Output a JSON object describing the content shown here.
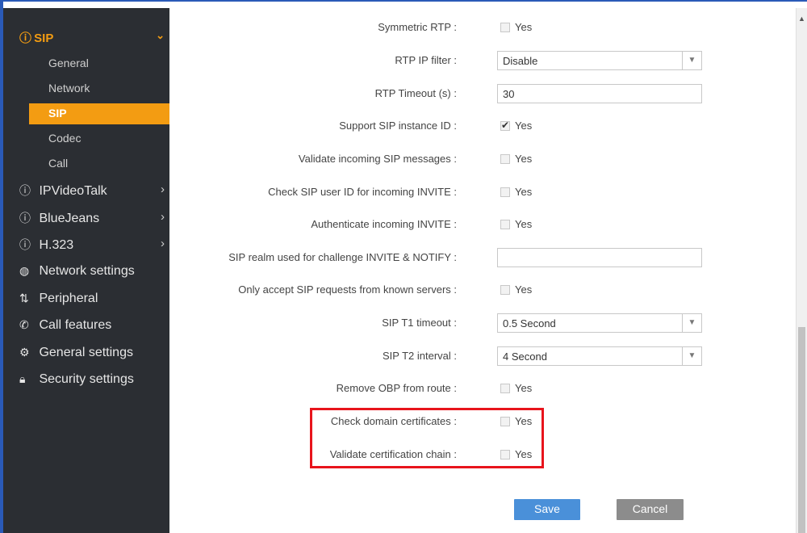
{
  "sidebar": {
    "sip_header": "SIP",
    "sub_items": [
      "General",
      "Network",
      "SIP",
      "Codec",
      "Call"
    ],
    "nav_items": [
      {
        "label": "IPVideoTalk",
        "icon": "info-circle-icon"
      },
      {
        "label": "BlueJeans",
        "icon": "info-circle-icon"
      },
      {
        "label": "H.323",
        "icon": "info-circle-icon"
      },
      {
        "label": "Network settings",
        "icon": "globe-icon"
      },
      {
        "label": "Peripheral",
        "icon": "plug-icon"
      },
      {
        "label": "Call features",
        "icon": "phone-icon"
      },
      {
        "label": "General settings",
        "icon": "gear-icon"
      },
      {
        "label": "Security settings",
        "icon": "lock-icon"
      }
    ]
  },
  "form": {
    "symmetric_rtp": {
      "label": "Symmetric RTP :",
      "checked": false,
      "yes": "Yes"
    },
    "rtp_ip_filter": {
      "label": "RTP IP filter :",
      "value": "Disable"
    },
    "rtp_timeout": {
      "label": "RTP Timeout (s) :",
      "value": "30"
    },
    "support_sip_instance_id": {
      "label": "Support SIP instance ID :",
      "checked": true,
      "yes": "Yes"
    },
    "validate_incoming": {
      "label": "Validate incoming SIP messages :",
      "checked": false,
      "yes": "Yes"
    },
    "check_sip_user_id": {
      "label": "Check SIP user ID for incoming INVITE :",
      "checked": false,
      "yes": "Yes"
    },
    "authenticate_invite": {
      "label": "Authenticate incoming INVITE :",
      "checked": false,
      "yes": "Yes"
    },
    "sip_realm": {
      "label": "SIP realm used for challenge INVITE & NOTIFY :",
      "value": ""
    },
    "only_accept_known": {
      "label": "Only accept SIP requests from known servers :",
      "checked": false,
      "yes": "Yes"
    },
    "sip_t1_timeout": {
      "label": "SIP T1 timeout :",
      "value": "0.5 Second"
    },
    "sip_t2_interval": {
      "label": "SIP T2 interval :",
      "value": "4 Second"
    },
    "remove_obp": {
      "label": "Remove OBP from route :",
      "checked": false,
      "yes": "Yes"
    },
    "check_domain_certs": {
      "label": "Check domain certificates :",
      "checked": false,
      "yes": "Yes"
    },
    "validate_cert_chain": {
      "label": "Validate certification chain :",
      "checked": false,
      "yes": "Yes"
    }
  },
  "buttons": {
    "save": "Save",
    "cancel": "Cancel"
  },
  "colors": {
    "accent": "#f39c12",
    "sidebar_bg": "#2b2e33",
    "save": "#4a90d9",
    "cancel": "#8c8c8c",
    "highlight": "#e8141c"
  }
}
